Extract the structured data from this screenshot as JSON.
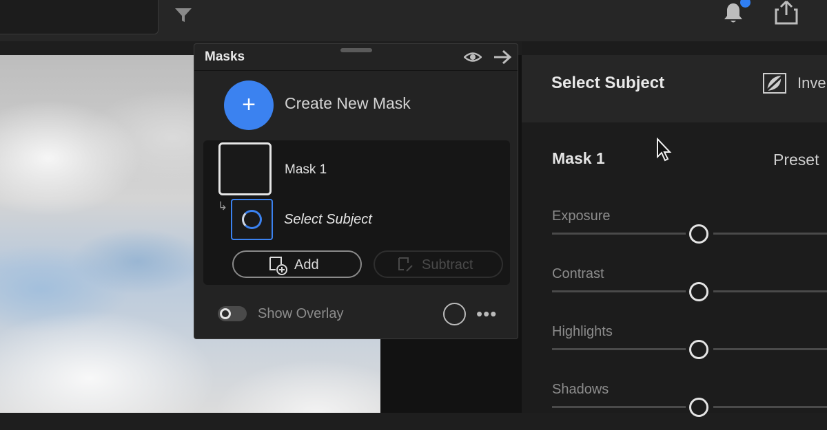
{
  "masks_panel": {
    "title": "Masks",
    "create_label": "Create New Mask",
    "create_button_glyph": "+",
    "mask": {
      "name": "Mask 1",
      "component": "Select Subject"
    },
    "add_label": "Add",
    "subtract_label": "Subtract",
    "overlay_label": "Show Overlay",
    "more_glyph": "•••"
  },
  "right_panel": {
    "header_title": "Select Subject",
    "invert_label": "Inver",
    "mask_title": "Mask 1",
    "preset_label": "Preset",
    "sliders": [
      {
        "label": "Exposure",
        "value": 0.5
      },
      {
        "label": "Contrast",
        "value": 0.5
      },
      {
        "label": "Highlights",
        "value": 0.5
      },
      {
        "label": "Shadows",
        "value": 0.5
      }
    ]
  },
  "colors": {
    "accent": "#3b82f0",
    "panel": "#232323",
    "background": "#1e1e1e"
  },
  "icons": [
    "filter-icon",
    "bell-icon",
    "share-icon",
    "eye-icon",
    "arrow-right-icon",
    "invert-icon"
  ]
}
